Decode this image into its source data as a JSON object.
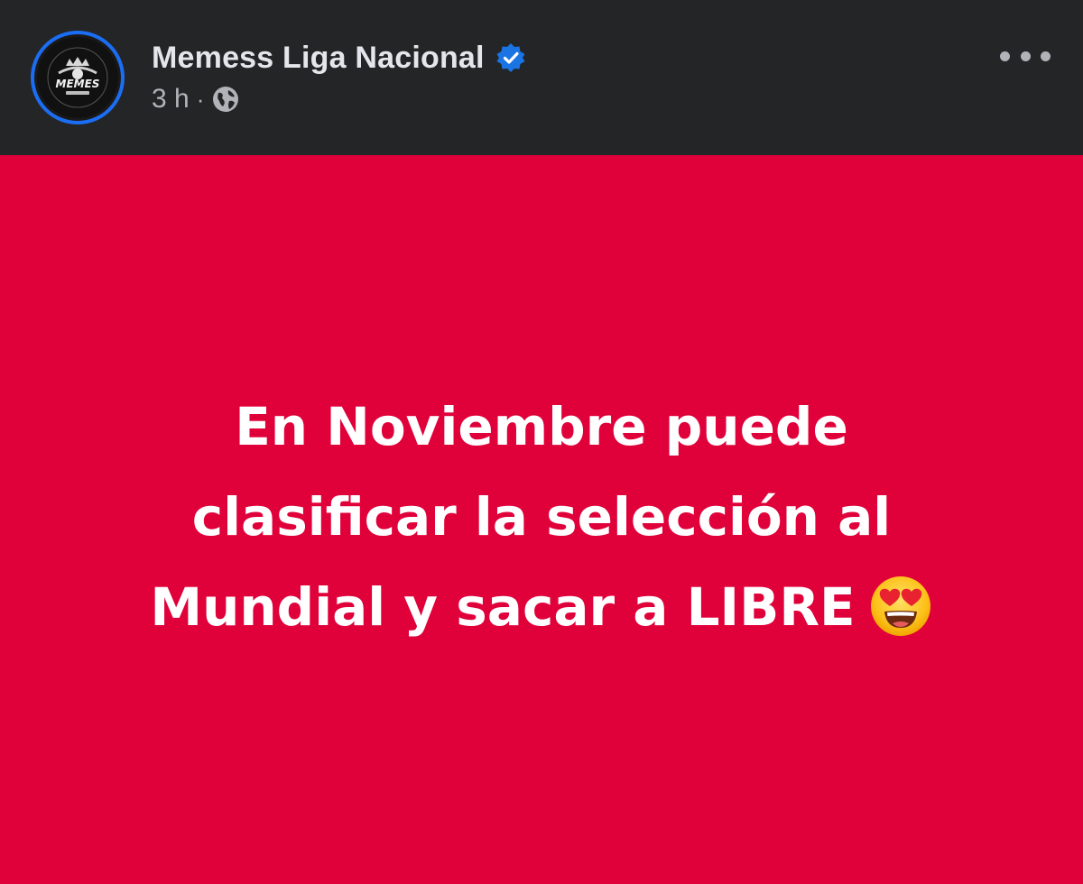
{
  "header": {
    "page_name": "Memess Liga Nacional",
    "time": "3 h",
    "separator": "·",
    "avatar_logo_text": "MEMES",
    "verified_icon": "verified-badge-icon",
    "audience_icon": "globe-icon",
    "more_icon": "more-options-icon"
  },
  "status": {
    "line1": "En Noviembre puede",
    "line2": "clasificar la selección al",
    "line3": "Mundial y sacar a LIBRE",
    "emoji_icon": "heart-eyes-emoji-icon",
    "background_color": "#e0003a",
    "text_color": "#ffffff"
  },
  "colors": {
    "header_bg": "#242526",
    "accent": "#1b6ef3"
  }
}
